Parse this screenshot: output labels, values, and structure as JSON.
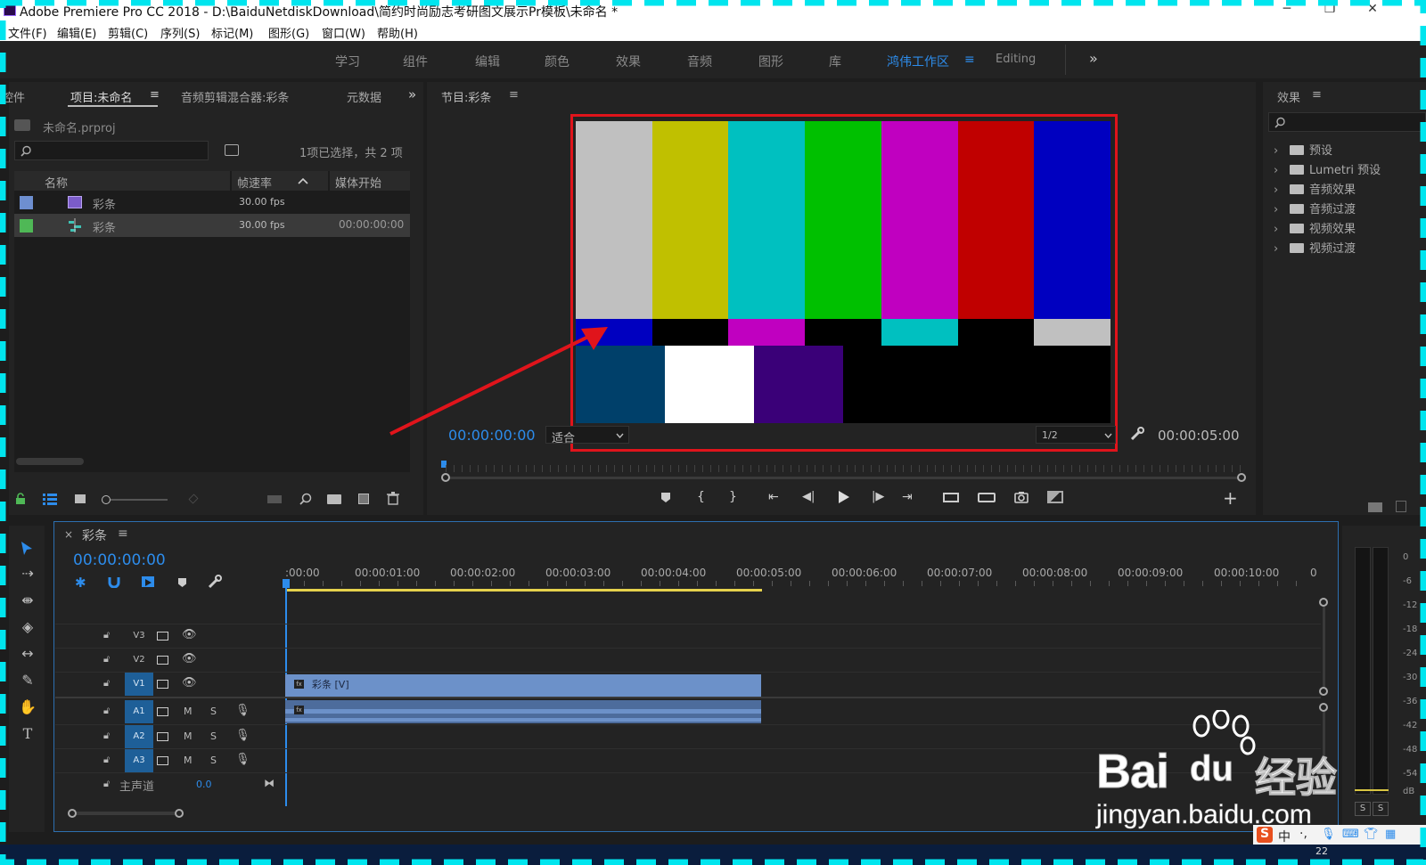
{
  "window": {
    "title": "Adobe Premiere Pro CC 2018 - D:\\BaiduNetdiskDownload\\简约时尚励志考研图文展示Pr模板\\未命名 *",
    "minimize": "─",
    "maximize": "❐",
    "close": "✕"
  },
  "menu": [
    "文件(F)",
    "编辑(E)",
    "剪辑(C)",
    "序列(S)",
    "标记(M)",
    "图形(G)",
    "窗口(W)",
    "帮助(H)"
  ],
  "workspaces": [
    "学习",
    "组件",
    "编辑",
    "颜色",
    "效果",
    "音频",
    "图形",
    "库",
    "鸿伟工作区",
    "Editing"
  ],
  "workspace_active": "鸿伟工作区",
  "workspace_more": "»",
  "project_panel": {
    "tabs": [
      "控件",
      "项目:未命名",
      "音频剪辑混合器:彩条",
      "元数据"
    ],
    "more": "»",
    "menu_icon": "≡",
    "file": "未命名.prproj",
    "selection_info": "1项已选择，共 2 项",
    "columns": [
      "名称",
      "帧速率",
      "媒体开始"
    ],
    "items": [
      {
        "name": "彩条",
        "fps": "30.00 fps",
        "start": "",
        "chip": "#6e8fd0"
      },
      {
        "name": "彩条",
        "fps": "30.00 fps",
        "start": "00:00:00:00",
        "chip": "#4fb856"
      }
    ]
  },
  "program_monitor": {
    "title": "节目:彩条",
    "menu_icon": "≡",
    "timecode_in": "00:00:00:00",
    "fit": "适合",
    "resolution": "1/2",
    "duration": "00:00:05:00",
    "colors": {
      "top": [
        "#c0c0c0",
        "#c0c000",
        "#00c0c0",
        "#00c000",
        "#c000c0",
        "#c00000",
        "#0000c0"
      ],
      "mid": [
        "#0000c0",
        "#000000",
        "#c000c0",
        "#000000",
        "#00c0c0",
        "#000000",
        "#c0c0c0"
      ],
      "bottom": [
        "#00406a",
        "#ffffff",
        "#3a0078",
        "#000000"
      ]
    },
    "add": "+"
  },
  "effects_panel": {
    "title": "效果",
    "menu_icon": "≡",
    "items": [
      "预设",
      "Lumetri 预设",
      "音频效果",
      "音频过渡",
      "视频效果",
      "视频过渡"
    ]
  },
  "timeline": {
    "close": "×",
    "sequence": "彩条",
    "menu_icon": "≡",
    "timecode": "00:00:00:00",
    "ruler": [
      ":00:00",
      "00:00:01:00",
      "00:00:02:00",
      "00:00:03:00",
      "00:00:04:00",
      "00:00:05:00",
      "00:00:06:00",
      "00:00:07:00",
      "00:00:08:00",
      "00:00:09:00",
      "00:00:10:00",
      "0"
    ],
    "video_tracks": [
      "V3",
      "V2",
      "V1"
    ],
    "audio_tracks": [
      "A1",
      "A2",
      "A3"
    ],
    "mute": "M",
    "solo": "S",
    "master": "主声道",
    "master_value": "0.0",
    "clip_label": "彩条 [V]",
    "fx_badge": "fx"
  },
  "meter": {
    "db_labels": [
      "0",
      "-6",
      "-12",
      "-18",
      "-24",
      "-30",
      "-36",
      "-42",
      "-48",
      "-54",
      "dB"
    ],
    "solo_buttons": [
      "S",
      "S"
    ]
  },
  "watermark": {
    "brand": "Bai",
    "brand2": "du",
    "brand3": "经验",
    "url": "jingyan.baidu.com"
  },
  "ime": {
    "label": "中",
    "punct": "·,",
    "clock": "22"
  }
}
